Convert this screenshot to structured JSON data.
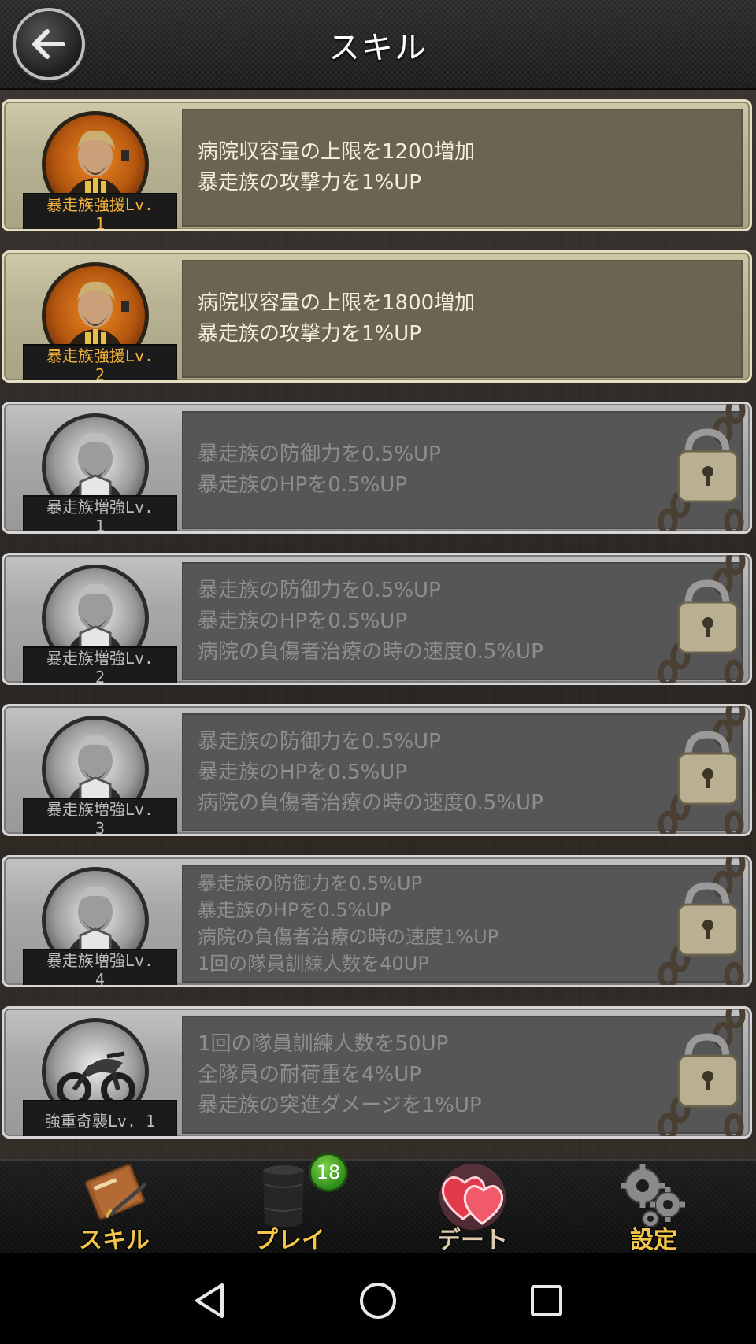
{
  "header": {
    "title": "スキル",
    "back_icon": "arrow-left-icon"
  },
  "skills": [
    {
      "state": "unlocked",
      "level_label": [
        "暴走族強援Lv.",
        "1"
      ],
      "icon": "gang-leader-bullets-icon",
      "description": [
        "病院収容量の上限を1200増加",
        "暴走族の攻撃力を1%UP"
      ]
    },
    {
      "state": "unlocked",
      "level_label": [
        "暴走族強援Lv.",
        "2"
      ],
      "icon": "gang-leader-bullets-icon",
      "description": [
        "病院収容量の上限を1800増加",
        "暴走族の攻撃力を1%UP"
      ]
    },
    {
      "state": "locked",
      "level_label": [
        "暴走族増強Lv.",
        "1"
      ],
      "icon": "gang-leader-shield-icon",
      "description": [
        "暴走族の防御力を0.5%UP",
        "暴走族のHPを0.5%UP"
      ]
    },
    {
      "state": "locked",
      "level_label": [
        "暴走族増強Lv.",
        "2"
      ],
      "icon": "gang-leader-shield-icon",
      "description": [
        "暴走族の防御力を0.5%UP",
        "暴走族のHPを0.5%UP",
        "病院の負傷者治療の時の速度0.5%UP"
      ]
    },
    {
      "state": "locked",
      "level_label": [
        "暴走族増強Lv.",
        "3"
      ],
      "icon": "gang-leader-shield-icon",
      "description": [
        "暴走族の防御力を0.5%UP",
        "暴走族のHPを0.5%UP",
        "病院の負傷者治療の時の速度0.5%UP"
      ]
    },
    {
      "state": "locked",
      "level_label": [
        "暴走族増強Lv.",
        "4"
      ],
      "icon": "gang-leader-shield-icon",
      "description": [
        "暴走族の防御力を0.5%UP",
        "暴走族のHPを0.5%UP",
        "病院の負傷者治療の時の速度1%UP",
        "1回の隊員訓練人数を40UP"
      ]
    },
    {
      "state": "locked",
      "level_label": [
        "強重奇襲Lv. 1"
      ],
      "icon": "motorcycle-icon",
      "description": [
        "1回の隊員訓練人数を50UP",
        "全隊員の耐荷重を4%UP",
        "暴走族の突進ダメージを1%UP"
      ]
    }
  ],
  "bottom_nav": [
    {
      "label": "スキル",
      "icon": "notebook-pen-icon"
    },
    {
      "label": "プレイ",
      "icon": "leather-cup-icon",
      "badge": "18"
    },
    {
      "label": "デート",
      "icon": "hearts-icon"
    },
    {
      "label": "設定",
      "icon": "gears-icon"
    }
  ],
  "system_nav": {
    "back": "triangle-back-icon",
    "home": "circle-home-icon",
    "recents": "square-recents-icon"
  },
  "colors": {
    "accent_gold": "#f3c64a",
    "unlocked_panel": "#6b6451",
    "locked_panel": "#565656",
    "badge_green": "#2e8e1a"
  }
}
